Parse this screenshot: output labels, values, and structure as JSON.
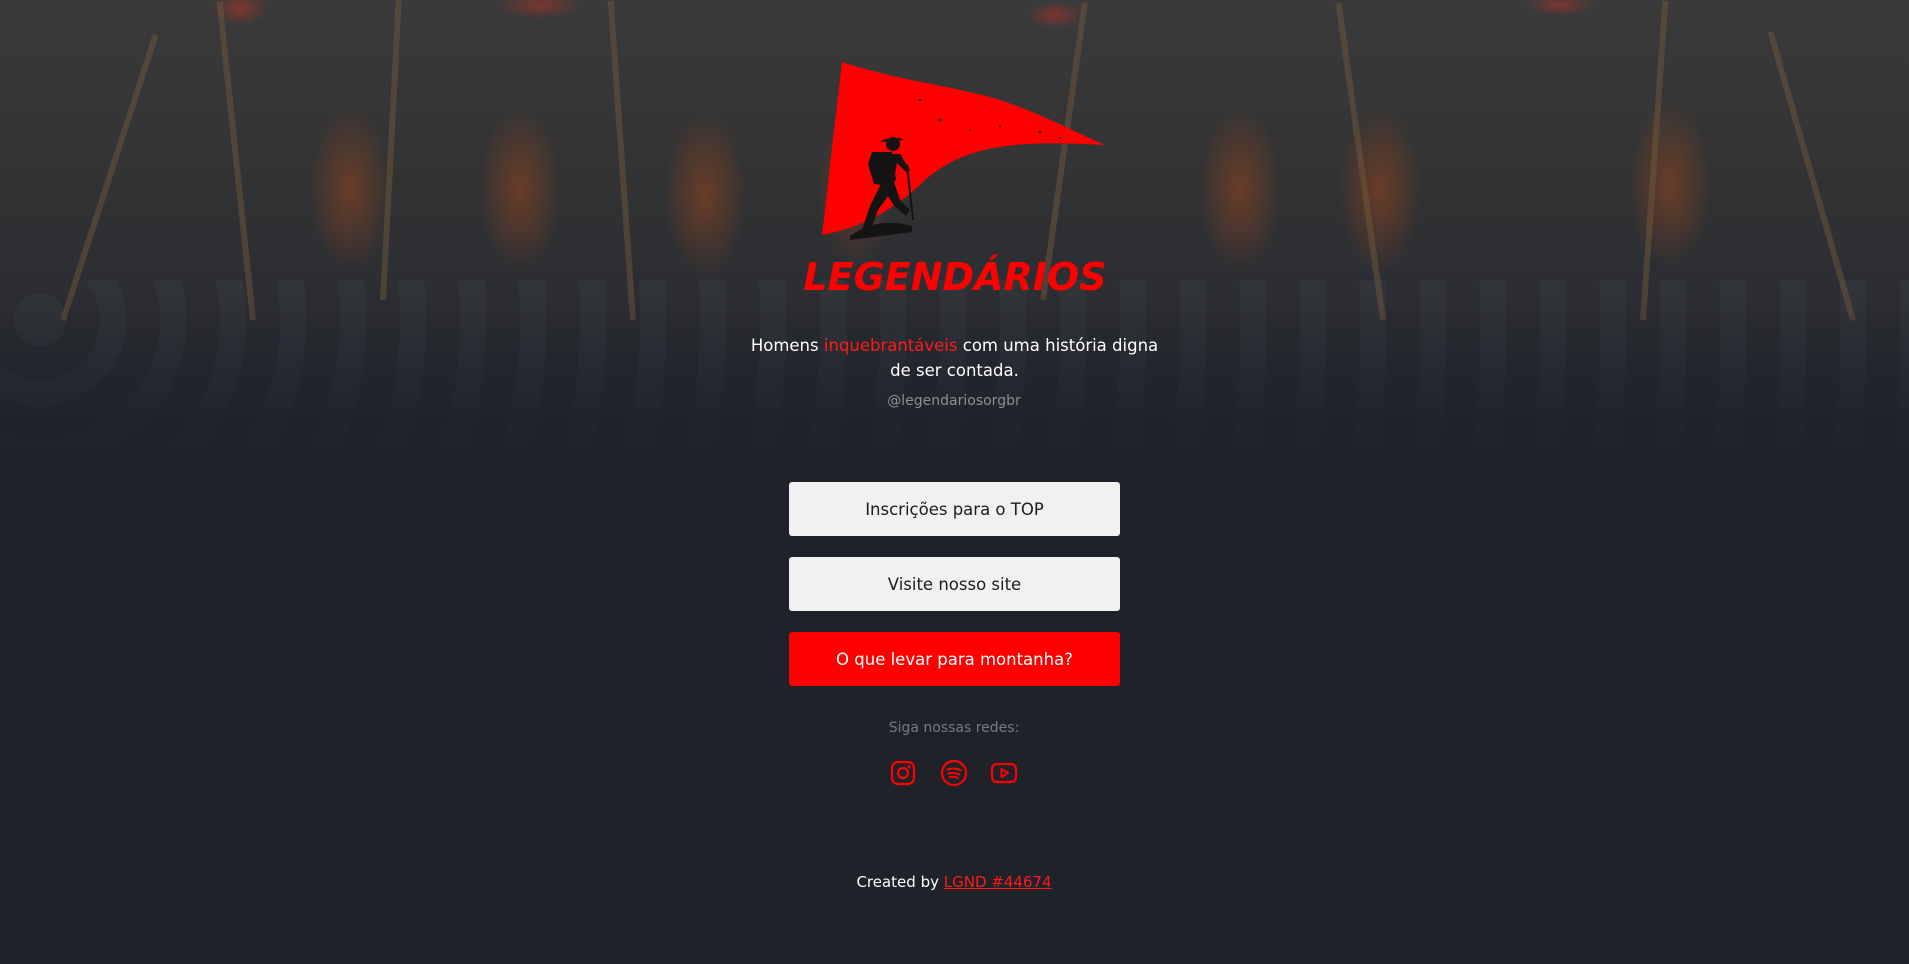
{
  "brand": {
    "logo_text": "LEGENDÁRIOS",
    "accent_color": "#ff0000",
    "background_color": "#20222a"
  },
  "hero": {
    "tagline_before": "Homens ",
    "tagline_accent": "inquebrantáveis",
    "tagline_after": " com uma história digna de ser contada.",
    "handle": "@legendariosorgbr"
  },
  "links": [
    {
      "label": "Inscrições para o TOP",
      "style": "light"
    },
    {
      "label": "Visite nosso site",
      "style": "light"
    },
    {
      "label": "O que levar para montanha?",
      "style": "red"
    }
  ],
  "social": {
    "label": "Siga nossas redes:",
    "icons": [
      "instagram-icon",
      "spotify-icon",
      "youtube-icon"
    ]
  },
  "footer": {
    "prefix": "Created by ",
    "link_text": "LGND #44674"
  }
}
